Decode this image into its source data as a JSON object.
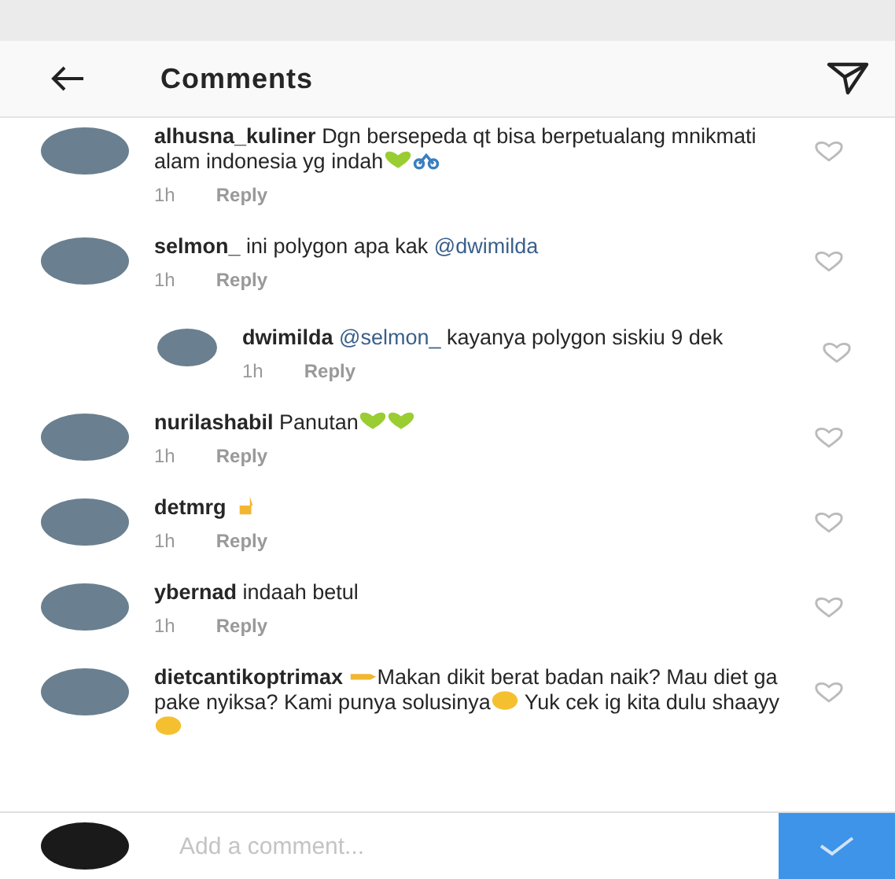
{
  "header": {
    "title": "Comments"
  },
  "comments": [
    {
      "username": "alhusna_kuliner",
      "body": [
        {
          "kind": "text",
          "text": "Dgn bersepeda qt bisa berpetualang mnikmati alam indonesia yg indah"
        },
        {
          "kind": "heart"
        },
        {
          "kind": "cyclist"
        }
      ],
      "time": "1h",
      "reply": "Reply"
    },
    {
      "username": "selmon_",
      "body": [
        {
          "kind": "text",
          "text": "ini polygon apa kak "
        },
        {
          "kind": "mention",
          "text": "@dwimilda"
        }
      ],
      "time": "1h",
      "reply": "Reply",
      "replies": [
        {
          "username": "dwimilda",
          "body": [
            {
              "kind": "mention",
              "text": "@selmon_"
            },
            {
              "kind": "text",
              "text": " kayanya polygon siskiu 9 dek"
            }
          ],
          "time": "1h",
          "reply": "Reply"
        }
      ]
    },
    {
      "username": "nurilashabil",
      "body": [
        {
          "kind": "text",
          "text": "Panutan"
        },
        {
          "kind": "heart"
        },
        {
          "kind": "heart"
        }
      ],
      "time": "1h",
      "reply": "Reply"
    },
    {
      "username": "detmrg",
      "body": [
        {
          "kind": "hand"
        }
      ],
      "time": "1h",
      "reply": "Reply"
    },
    {
      "username": "ybernad",
      "body": [
        {
          "kind": "text",
          "text": "indaah betul"
        }
      ],
      "time": "1h",
      "reply": "Reply"
    },
    {
      "username": "dietcantikoptrimax",
      "body": [
        {
          "kind": "pointer"
        },
        {
          "kind": "text",
          "text": "Makan dikit berat badan naik? Mau diet ga pake nyiksa? Kami punya solusinya"
        },
        {
          "kind": "face"
        },
        {
          "kind": "text",
          "text": " Yuk cek ig kita dulu shaayy"
        },
        {
          "kind": "face"
        }
      ]
    }
  ],
  "composer": {
    "placeholder": "Add a comment..."
  }
}
